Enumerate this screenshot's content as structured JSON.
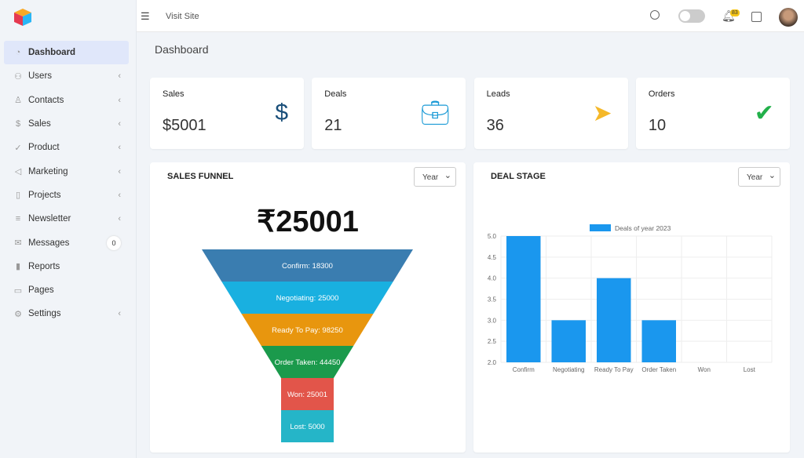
{
  "sidebar": {
    "items": [
      {
        "label": "Dashboard",
        "icon": "gauge-icon",
        "chevron": false
      },
      {
        "label": "Users",
        "icon": "users-icon",
        "chevron": true
      },
      {
        "label": "Contacts",
        "icon": "user-icon",
        "chevron": true
      },
      {
        "label": "Sales",
        "icon": "dollar-icon",
        "chevron": true
      },
      {
        "label": "Product",
        "icon": "bag-icon",
        "chevron": true
      },
      {
        "label": "Marketing",
        "icon": "megaphone-icon",
        "chevron": true
      },
      {
        "label": "Projects",
        "icon": "notebook-icon",
        "chevron": true
      },
      {
        "label": "Newsletter",
        "icon": "newspaper-icon",
        "chevron": true
      },
      {
        "label": "Messages",
        "icon": "mail-icon",
        "badge": "0"
      },
      {
        "label": "Reports",
        "icon": "bar-chart-icon",
        "chevron": false
      },
      {
        "label": "Pages",
        "icon": "file-icon",
        "chevron": false
      },
      {
        "label": "Settings",
        "icon": "gear-icon",
        "chevron": true
      }
    ]
  },
  "topbar": {
    "visit": "Visit Site",
    "notifications": "83"
  },
  "page_title": "Dashboard",
  "stats": [
    {
      "label": "Sales",
      "value": "$5001",
      "icon": "dollar-icon",
      "color": "#1a4f7a"
    },
    {
      "label": "Deals",
      "value": "21",
      "icon": "briefcase-icon",
      "color": "#1a9ad6"
    },
    {
      "label": "Leads",
      "value": "36",
      "icon": "paper-plane-icon",
      "color": "#f5b829"
    },
    {
      "label": "Orders",
      "value": "10",
      "icon": "shopping-bag-icon",
      "color": "#22b04a"
    }
  ],
  "funnel": {
    "title": "SALES FUNNEL",
    "select": "Year",
    "amount": "₹25001",
    "stages": [
      {
        "label": "Confirm: 18300",
        "color": "#3a7db0"
      },
      {
        "label": "Negotiating: 25000",
        "color": "#19b0e0"
      },
      {
        "label": "Ready To Pay: 98250",
        "color": "#e8960e"
      },
      {
        "label": "Order Taken: 44450",
        "color": "#1b9a4c"
      },
      {
        "label": "Won: 25001",
        "color": "#e2554a"
      },
      {
        "label": "Lost: 5000",
        "color": "#25b5c8"
      }
    ]
  },
  "deal": {
    "title": "DEAL STAGE",
    "select": "Year"
  },
  "chart_data": {
    "type": "bar",
    "categories": [
      "Confirm",
      "Negotiating",
      "Ready To Pay",
      "Order Taken",
      "Won",
      "Lost"
    ],
    "series": [
      {
        "name": "Deals of year 2023",
        "values": [
          5,
          3,
          4,
          3,
          0,
          0
        ],
        "color": "#1a97ee"
      }
    ],
    "ylim": [
      2,
      5
    ],
    "yticks": [
      "2.0",
      "2.5",
      "3.0",
      "3.5",
      "4.0",
      "4.5",
      "5.0"
    ],
    "legend": "top",
    "grid": true
  }
}
